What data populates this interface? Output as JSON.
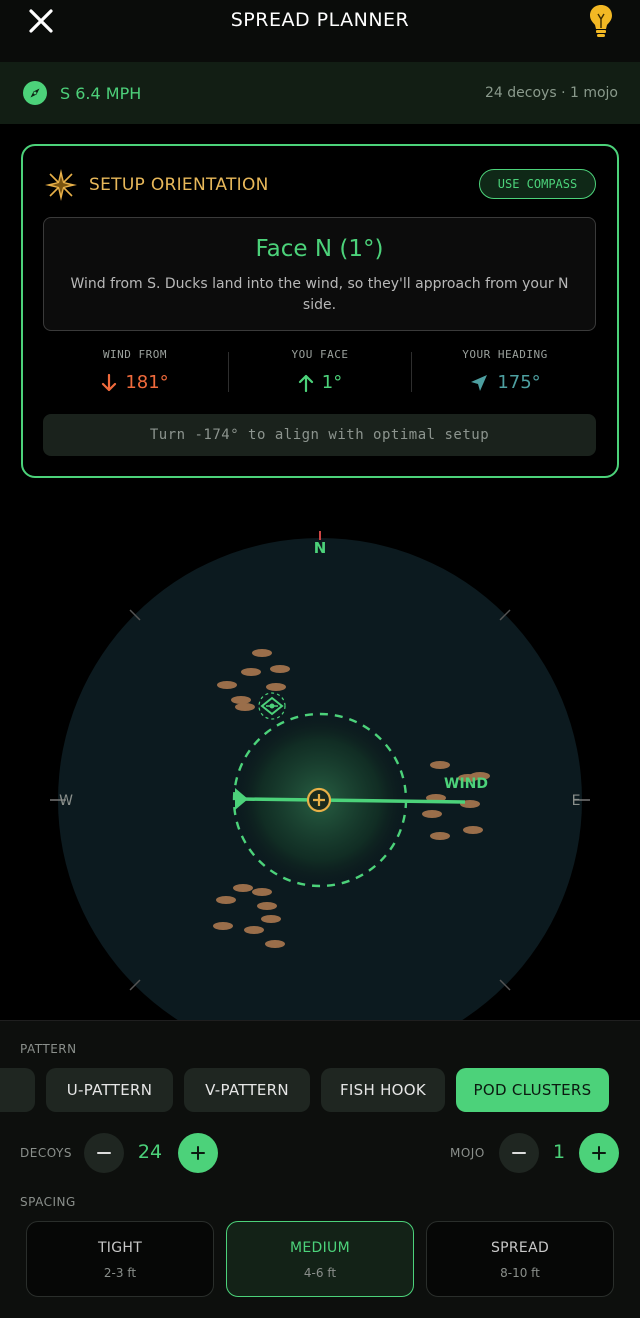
{
  "header": {
    "title": "SPREAD PLANNER"
  },
  "status": {
    "wind": "S 6.4 MPH",
    "summary": "24 decoys · 1 mojo"
  },
  "orientation": {
    "title": "SETUP ORIENTATION",
    "compass_button": "USE COMPASS",
    "face_title": "Face N (1°)",
    "face_description": "Wind from S. Ducks land into the wind, so they'll approach from your N side.",
    "stats": [
      {
        "label": "WIND FROM",
        "value": "181°",
        "color": "#f06a3c"
      },
      {
        "label": "YOU FACE",
        "value": "1°",
        "color": "#4cd27a"
      },
      {
        "label": "YOUR HEADING",
        "value": "175°",
        "color": "#4d9fa0"
      }
    ],
    "turn_hint": "Turn -174° to align with optimal setup"
  },
  "radar": {
    "north": "N",
    "west": "W",
    "east": "E",
    "wind_label": "WIND",
    "colors": {
      "accent": "#4cd27a",
      "center": "#e8b048",
      "decoy": "#9a6e4a"
    }
  },
  "pattern": {
    "label": "PATTERN",
    "options": [
      "U-PATTERN",
      "V-PATTERN",
      "FISH HOOK",
      "POD CLUSTERS"
    ],
    "selected": "POD CLUSTERS"
  },
  "decoys": {
    "label": "DECOYS",
    "count": "24"
  },
  "mojo": {
    "label": "MOJO",
    "count": "1"
  },
  "spacing": {
    "label": "SPACING",
    "options": [
      {
        "name": "TIGHT",
        "range": "2-3 ft"
      },
      {
        "name": "MEDIUM",
        "range": "4-6 ft"
      },
      {
        "name": "SPREAD",
        "range": "8-10 ft"
      }
    ],
    "selected": "MEDIUM"
  }
}
